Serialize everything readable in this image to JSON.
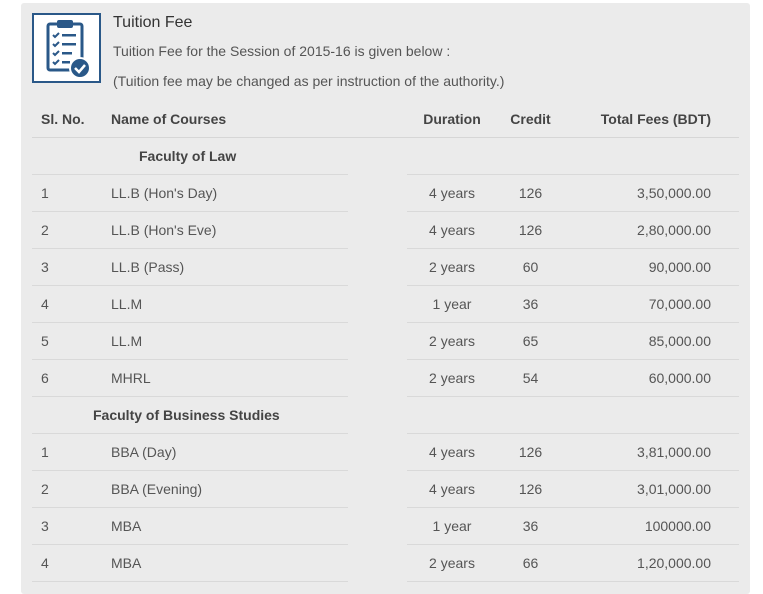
{
  "header": {
    "title": "Tuition Fee",
    "subtitle": "Tuition Fee for the Session of 2015-16 is given below :",
    "note": "(Tuition fee may be changed as per instruction of the authority.)",
    "icon": "clipboard-check-icon",
    "accent_color": "#2a5888"
  },
  "table": {
    "columns": [
      "Sl. No.",
      "Name of Courses",
      "Duration",
      "Credit",
      "Total Fees (BDT)"
    ],
    "faculties": [
      {
        "name": "Faculty of Law",
        "rows": [
          {
            "sl": "1",
            "course": "LL.B (Hon's Day)",
            "duration": "4 years",
            "credit": "126",
            "fee": "3,50,000.00"
          },
          {
            "sl": "2",
            "course": "LL.B (Hon's Eve)",
            "duration": "4 years",
            "credit": "126",
            "fee": "2,80,000.00"
          },
          {
            "sl": "3",
            "course": "LL.B (Pass)",
            "duration": "2 years",
            "credit": "60",
            "fee": "90,000.00"
          },
          {
            "sl": "4",
            "course": "LL.M",
            "duration": "1 year",
            "credit": "36",
            "fee": "70,000.00"
          },
          {
            "sl": "5",
            "course": "LL.M",
            "duration": "2 years",
            "credit": "65",
            "fee": "85,000.00"
          },
          {
            "sl": "6",
            "course": "MHRL",
            "duration": "2 years",
            "credit": "54",
            "fee": "60,000.00"
          }
        ]
      },
      {
        "name": "Faculty of Business Studies",
        "rows": [
          {
            "sl": "1",
            "course": "BBA (Day)",
            "duration": "4 years",
            "credit": "126",
            "fee": "3,81,000.00"
          },
          {
            "sl": "2",
            "course": "BBA (Evening)",
            "duration": "4 years",
            "credit": "126",
            "fee": "3,01,000.00"
          },
          {
            "sl": "3",
            "course": "MBA",
            "duration": "1 year",
            "credit": "36",
            "fee": "100000.00"
          },
          {
            "sl": "4",
            "course": "MBA",
            "duration": "2 years",
            "credit": "66",
            "fee": "1,20,000.00"
          }
        ]
      }
    ]
  }
}
